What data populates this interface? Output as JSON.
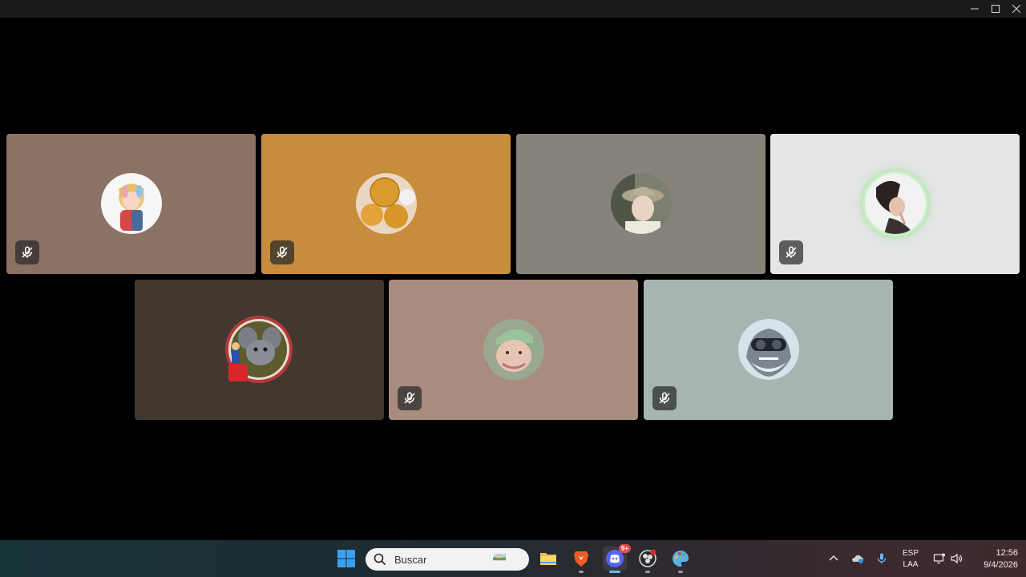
{
  "window": {
    "controls": [
      "minimize",
      "maximize",
      "close"
    ]
  },
  "call": {
    "participants": [
      {
        "id": "p1",
        "avatar": "cartoon-girl-avatar",
        "tile_color": "#8c7264",
        "muted": true
      },
      {
        "id": "p2",
        "avatar": "bread-rolls-avatar",
        "tile_color": "#c78d3c",
        "muted": true
      },
      {
        "id": "p3",
        "avatar": "person-bucket-hat-avatar",
        "tile_color": "#87837b",
        "muted": false
      },
      {
        "id": "p4",
        "avatar": "person-dark-hair-avatar",
        "tile_color": "#e4e5e6",
        "muted": true,
        "speaking": true,
        "speaking_ring_color": "#a6e3a1"
      },
      {
        "id": "p5",
        "avatar": "cartoon-mouse-avatar",
        "tile_color": "#423830",
        "muted": false
      },
      {
        "id": "p6",
        "avatar": "person-green-cap-avatar",
        "tile_color": "#a88c7e",
        "muted": true
      },
      {
        "id": "p7",
        "avatar": "shark-goggles-avatar",
        "tile_color": "#a6b5b1",
        "muted": true
      }
    ],
    "muted_icon": "mic-muted-icon"
  },
  "taskbar": {
    "start_icon": "windows-start-icon",
    "search": {
      "placeholder": "Buscar"
    },
    "apps": [
      {
        "name": "file-explorer-icon",
        "running": false
      },
      {
        "name": "brave-browser-icon",
        "running": true
      },
      {
        "name": "discord-icon",
        "running": true,
        "active": true,
        "badge": "9+"
      },
      {
        "name": "obs-studio-icon",
        "running": true
      },
      {
        "name": "paint-icon",
        "running": true
      }
    ],
    "tray": {
      "lang_line1": "ESP",
      "lang_line2": "LAA",
      "time": "12:56",
      "date": "9/4/2026"
    }
  },
  "colors": {
    "titlebar": "#1a1a1c",
    "background": "#000000",
    "discord_blurple": "#5865f2",
    "accent_blue": "#6cb6ff"
  }
}
